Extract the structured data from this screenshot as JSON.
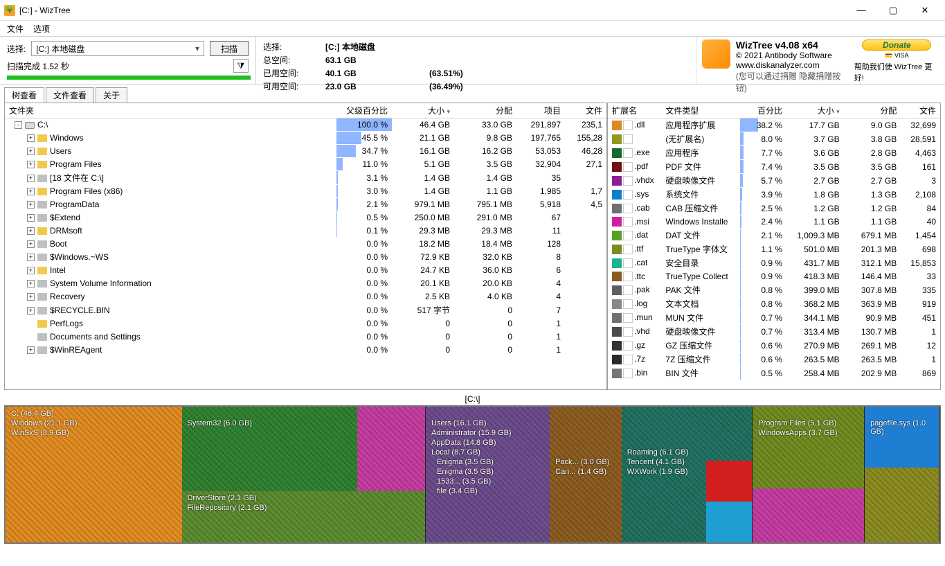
{
  "window": {
    "title": "[C:]  -  WizTree"
  },
  "menu": {
    "file": "文件",
    "options": "选项"
  },
  "toolbar": {
    "select_label": "选择:",
    "drive": "[C:] 本地磁盘",
    "scan": "扫描",
    "scan_done": "扫描完成 1.52 秒"
  },
  "stats": {
    "labels": {
      "sel": "选择:",
      "total": "总空间:",
      "used": "已用空间:",
      "free": "可用空间:"
    },
    "sel_val": "[C:]  本地磁盘",
    "total_val": "63.1 GB",
    "used_val": "40.1 GB",
    "used_pct": "(63.51%)",
    "free_val": "23.0 GB",
    "free_pct": "(36.49%)"
  },
  "brand": {
    "name": "WizTree v4.08 x64",
    "copyright": "© 2021 Antibody Software",
    "site": "www.diskanalyzer.com",
    "hint": "(您可以通过捐赠 隐藏捐赠按钮)",
    "donate": "Donate",
    "cards": "💳 VISA",
    "help": "帮助我们使 WizTree 更好!"
  },
  "tabs": {
    "tree": "树查看",
    "file": "文件查看",
    "about": "关于"
  },
  "tree_headers": {
    "folder": "文件夹",
    "pct": "父级百分比",
    "size": "大小",
    "alloc": "分配",
    "items": "项目",
    "files": "文件"
  },
  "tree_rows": [
    {
      "depth": 0,
      "exp": "-",
      "icon": "drive",
      "name": "C:\\",
      "pct": 100.0,
      "size": "46.4 GB",
      "alloc": "33.0 GB",
      "items": "291,897",
      "files": "235,1"
    },
    {
      "depth": 1,
      "exp": "+",
      "icon": "folder",
      "name": "Windows",
      "pct": 45.5,
      "size": "21.1 GB",
      "alloc": "9.8 GB",
      "items": "197,765",
      "files": "155,28"
    },
    {
      "depth": 1,
      "exp": "+",
      "icon": "folder",
      "name": "Users",
      "pct": 34.7,
      "size": "16.1 GB",
      "alloc": "16.2 GB",
      "items": "53,053",
      "files": "46,28"
    },
    {
      "depth": 1,
      "exp": "+",
      "icon": "folder",
      "name": "Program Files",
      "pct": 11.0,
      "size": "5.1 GB",
      "alloc": "3.5 GB",
      "items": "32,904",
      "files": "27,1"
    },
    {
      "depth": 1,
      "exp": "+",
      "icon": "gfolder",
      "name": "[18 文件在 C:\\]",
      "pct": 3.1,
      "size": "1.4 GB",
      "alloc": "1.4 GB",
      "items": "35",
      "files": ""
    },
    {
      "depth": 1,
      "exp": "+",
      "icon": "folder",
      "name": "Program Files (x86)",
      "pct": 3.0,
      "size": "1.4 GB",
      "alloc": "1.1 GB",
      "items": "1,985",
      "files": "1,7"
    },
    {
      "depth": 1,
      "exp": "+",
      "icon": "gfolder",
      "name": "ProgramData",
      "pct": 2.1,
      "size": "979.1 MB",
      "alloc": "795.1 MB",
      "items": "5,918",
      "files": "4,5"
    },
    {
      "depth": 1,
      "exp": "+",
      "icon": "gfolder",
      "name": "$Extend",
      "pct": 0.5,
      "size": "250.0 MB",
      "alloc": "291.0 MB",
      "items": "67",
      "files": ""
    },
    {
      "depth": 1,
      "exp": "+",
      "icon": "folder",
      "name": "DRMsoft",
      "pct": 0.1,
      "size": "29.3 MB",
      "alloc": "29.3 MB",
      "items": "11",
      "files": ""
    },
    {
      "depth": 1,
      "exp": "+",
      "icon": "gfolder",
      "name": "Boot",
      "pct": 0.0,
      "size": "18.2 MB",
      "alloc": "18.4 MB",
      "items": "128",
      "files": ""
    },
    {
      "depth": 1,
      "exp": "+",
      "icon": "gfolder",
      "name": "$Windows.~WS",
      "pct": 0.0,
      "size": "72.9 KB",
      "alloc": "32.0 KB",
      "items": "8",
      "files": ""
    },
    {
      "depth": 1,
      "exp": "+",
      "icon": "folder",
      "name": "Intel",
      "pct": 0.0,
      "size": "24.7 KB",
      "alloc": "36.0 KB",
      "items": "6",
      "files": ""
    },
    {
      "depth": 1,
      "exp": "+",
      "icon": "gfolder",
      "name": "System Volume Information",
      "pct": 0.0,
      "size": "20.1 KB",
      "alloc": "20.0 KB",
      "items": "4",
      "files": ""
    },
    {
      "depth": 1,
      "exp": "+",
      "icon": "gfolder",
      "name": "Recovery",
      "pct": 0.0,
      "size": "2.5 KB",
      "alloc": "4.0 KB",
      "items": "4",
      "files": ""
    },
    {
      "depth": 1,
      "exp": "+",
      "icon": "gfolder",
      "name": "$RECYCLE.BIN",
      "pct": 0.0,
      "size": "517 字节",
      "alloc": "0",
      "items": "7",
      "files": ""
    },
    {
      "depth": 1,
      "exp": "",
      "icon": "folder",
      "name": "PerfLogs",
      "pct": 0.0,
      "size": "0",
      "alloc": "0",
      "items": "1",
      "files": ""
    },
    {
      "depth": 1,
      "exp": "",
      "icon": "gfolder",
      "name": "Documents and Settings",
      "pct": 0.0,
      "size": "0",
      "alloc": "0",
      "items": "1",
      "files": ""
    },
    {
      "depth": 1,
      "exp": "+",
      "icon": "gfolder",
      "name": "$WinREAgent",
      "pct": 0.0,
      "size": "0",
      "alloc": "0",
      "items": "1",
      "files": ""
    }
  ],
  "ext_headers": {
    "ext": "扩展名",
    "type": "文件类型",
    "pct": "百分比",
    "size": "大小",
    "alloc": "分配",
    "files": "文件"
  },
  "ext_rows": [
    {
      "c": "#e08a1e",
      "ext": ".dll",
      "type": "应用程序扩展",
      "pct": 38.2,
      "size": "17.7 GB",
      "alloc": "9.0 GB",
      "files": "32,699"
    },
    {
      "c": "#92971f",
      "ext": "",
      "type": "(无扩展名)",
      "pct": 8.0,
      "size": "3.7 GB",
      "alloc": "3.8 GB",
      "files": "28,591"
    },
    {
      "c": "#0f6b2f",
      "ext": ".exe",
      "type": "应用程序",
      "pct": 7.7,
      "size": "3.6 GB",
      "alloc": "2.8 GB",
      "files": "4,463"
    },
    {
      "c": "#730f0f",
      "ext": ".pdf",
      "type": "PDF 文件",
      "pct": 7.4,
      "size": "3.5 GB",
      "alloc": "3.5 GB",
      "files": "161"
    },
    {
      "c": "#8a1e96",
      "ext": ".vhdx",
      "type": "硬盘映像文件",
      "pct": 5.7,
      "size": "2.7 GB",
      "alloc": "2.7 GB",
      "files": "3"
    },
    {
      "c": "#0c7fc9",
      "ext": ".sys",
      "type": "系统文件",
      "pct": 3.9,
      "size": "1.8 GB",
      "alloc": "1.3 GB",
      "files": "2,108"
    },
    {
      "c": "#6f6f6f",
      "ext": ".cab",
      "type": "CAB 压缩文件",
      "pct": 2.5,
      "size": "1.2 GB",
      "alloc": "1.2 GB",
      "files": "84"
    },
    {
      "c": "#d21ea2",
      "ext": ".msi",
      "type": "Windows Installe",
      "pct": 2.4,
      "size": "1.1 GB",
      "alloc": "1.1 GB",
      "files": "40"
    },
    {
      "c": "#5aa026",
      "ext": ".dat",
      "type": "DAT 文件",
      "pct": 2.1,
      "size": "1,009.3 MB",
      "alloc": "679.1 MB",
      "files": "1,454"
    },
    {
      "c": "#7f8a1e",
      "ext": ".ttf",
      "type": "TrueType 字体文",
      "pct": 1.1,
      "size": "501.0 MB",
      "alloc": "201.3 MB",
      "files": "698"
    },
    {
      "c": "#19b38f",
      "ext": ".cat",
      "type": "安全目录",
      "pct": 0.9,
      "size": "431.7 MB",
      "alloc": "312.1 MB",
      "files": "15,853"
    },
    {
      "c": "#8a5a1e",
      "ext": ".ttc",
      "type": "TrueType Collect",
      "pct": 0.9,
      "size": "418.3 MB",
      "alloc": "146.4 MB",
      "files": "33"
    },
    {
      "c": "#5f5f5f",
      "ext": ".pak",
      "type": "PAK 文件",
      "pct": 0.8,
      "size": "399.0 MB",
      "alloc": "307.8 MB",
      "files": "335"
    },
    {
      "c": "#888888",
      "ext": ".log",
      "type": "文本文档",
      "pct": 0.8,
      "size": "368.2 MB",
      "alloc": "363.9 MB",
      "files": "919"
    },
    {
      "c": "#707070",
      "ext": ".mun",
      "type": "MUN 文件",
      "pct": 0.7,
      "size": "344.1 MB",
      "alloc": "90.9 MB",
      "files": "451"
    },
    {
      "c": "#4a4a4a",
      "ext": ".vhd",
      "type": "硬盘映像文件",
      "pct": 0.7,
      "size": "313.4 MB",
      "alloc": "130.7 MB",
      "files": "1"
    },
    {
      "c": "#333333",
      "ext": ".gz",
      "type": "GZ 压缩文件",
      "pct": 0.6,
      "size": "270.9 MB",
      "alloc": "269.1 MB",
      "files": "12"
    },
    {
      "c": "#2a2a2a",
      "ext": ".7z",
      "type": "7Z 压缩文件",
      "pct": 0.6,
      "size": "263.5 MB",
      "alloc": "263.5 MB",
      "files": "1"
    },
    {
      "c": "#777777",
      "ext": ".bin",
      "type": "BIN 文件",
      "pct": 0.5,
      "size": "258.4 MB",
      "alloc": "202.9 MB",
      "files": "869"
    }
  ],
  "treemap": {
    "title": "[C:\\]",
    "labels": {
      "root": "C: (46.4 GB)",
      "windows": "Windows (21.1 GB)",
      "winsxs": "WinSxS (8.9 GB)",
      "system32": "System32 (6.0 GB)",
      "driverstore": "DriverStore (2.1 GB)",
      "filerepo": "FileRepository (2.1 GB)",
      "users": "Users (16.1 GB)",
      "admin": "Administrator (15.9 GB)",
      "appdata": "AppData (14.8 GB)",
      "local": "Local (8.7 GB)",
      "enigma1": "Enigma (3.5 GB)",
      "enigma2": "Enigma (3.5 GB)",
      "n1533": "1533... (3.5 GB)",
      "file34": "file (3.4 GB)",
      "pack": "Pack... (3.0 GB)",
      "can": "Can... (1.4 GB)",
      "roaming": "Roaming (6.1 GB)",
      "tencent": "Tencent (4.1 GB)",
      "wxwork": "WXWork (1.9 GB)",
      "pf": "Program Files (5.1 GB)",
      "winapps": "WindowsApps (3.7 GB)",
      "pagefile": "pagefile.sys (1.0 GB)"
    }
  }
}
